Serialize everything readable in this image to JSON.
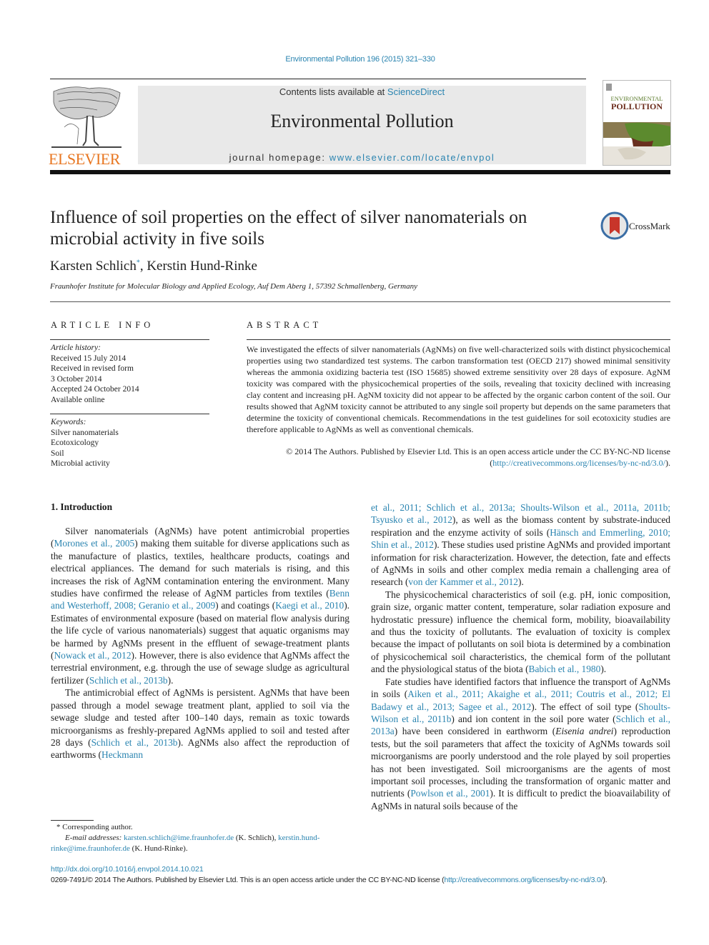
{
  "header": {
    "journal_reference": "Environmental Pollution 196 (2015) 321–330",
    "contents_prefix": "Contents lists available at ",
    "contents_link": "ScienceDirect",
    "journal_title": "Environmental Pollution",
    "homepage_prefix": "journal homepage: ",
    "homepage_link": "www.elsevier.com/locate/envpol",
    "publisher_logo": "ELSEVIER",
    "cover": {
      "title_line1": "ENVIRONMENTAL",
      "title_line2": "POLLUTION"
    },
    "colors": {
      "link": "#2a84b0",
      "elsevier_orange": "#e87722",
      "banner_bg": "#e9e9e9"
    }
  },
  "article": {
    "title": "Influence of soil properties on the effect of silver nanomaterials on microbial activity in five soils",
    "crossmark_label": "CrossMark",
    "authors": [
      {
        "name": "Karsten Schlich",
        "mark": "*"
      },
      {
        "name": "Kerstin Hund-Rinke",
        "mark": ""
      }
    ],
    "author_separator": ", ",
    "affiliation": "Fraunhofer Institute for Molecular Biology and Applied Ecology, Auf Dem Aberg 1, 57392 Schmallenberg, Germany"
  },
  "article_info": {
    "heading": "ARTICLE INFO",
    "history_label": "Article history:",
    "history": [
      "Received 15 July 2014",
      "Received in revised form",
      "3 October 2014",
      "Accepted 24 October 2014",
      "Available online"
    ],
    "keywords_label": "Keywords:",
    "keywords": [
      "Silver nanomaterials",
      "Ecotoxicology",
      "Soil",
      "Microbial activity"
    ]
  },
  "abstract": {
    "heading": "ABSTRACT",
    "text": "We investigated the effects of silver nanomaterials (AgNMs) on five well-characterized soils with distinct physicochemical properties using two standardized test systems. The carbon transformation test (OECD 217) showed minimal sensitivity whereas the ammonia oxidizing bacteria test (ISO 15685) showed extreme sensitivity over 28 days of exposure. AgNM toxicity was compared with the physicochemical properties of the soils, revealing that toxicity declined with increasing clay content and increasing pH. AgNM toxicity did not appear to be affected by the organic carbon content of the soil. Our results showed that AgNM toxicity cannot be attributed to any single soil property but depends on the same parameters that determine the toxicity of conventional chemicals. Recommendations in the test guidelines for soil ecotoxicity studies are therefore applicable to AgNMs as well as conventional chemicals.",
    "copyright_prefix": "© 2014 The Authors. Published by Elsevier Ltd. This is an open access article under the CC BY-NC-ND license (",
    "copyright_link": "http://creativecommons.org/licenses/by-nc-nd/3.0/",
    "copyright_suffix": ")."
  },
  "body": {
    "section_heading": "1.  Introduction",
    "left_paragraphs": [
      [
        {
          "t": "Silver nanomaterials (AgNMs) have potent antimicrobial properties ("
        },
        {
          "t": "Morones et al., 2005",
          "link": true
        },
        {
          "t": ") making them suitable for diverse applications such as the manufacture of plastics, textiles, healthcare products, coatings and electrical appliances. The demand for such materials is rising, and this increases the risk of AgNM contamination entering the environment. Many studies have confirmed the release of AgNM particles from textiles ("
        },
        {
          "t": "Benn and Westerhoff, 2008; Geranio et al., 2009",
          "link": true
        },
        {
          "t": ") and coatings ("
        },
        {
          "t": "Kaegi et al., 2010",
          "link": true
        },
        {
          "t": "). Estimates of environmental exposure (based on material flow analysis during the life cycle of various nanomaterials) suggest that aquatic organisms may be harmed by AgNMs present in the effluent of sewage-treatment plants ("
        },
        {
          "t": "Nowack et al., 2012",
          "link": true
        },
        {
          "t": "). However, there is also evidence that AgNMs affect the terrestrial environment, e.g. through the use of sewage sludge as agricultural fertilizer ("
        },
        {
          "t": "Schlich et al., 2013b",
          "link": true
        },
        {
          "t": ")."
        }
      ],
      [
        {
          "t": "The antimicrobial effect of AgNMs is persistent. AgNMs that have been passed through a model sewage treatment plant, applied to soil via the sewage sludge and tested after 100–140 days, remain as toxic towards microorganisms as freshly-prepared AgNMs applied to soil and tested after 28 days ("
        },
        {
          "t": "Schlich et al., 2013b",
          "link": true
        },
        {
          "t": "). AgNMs also affect the reproduction of earthworms ("
        },
        {
          "t": "Heckmann",
          "link": true
        }
      ]
    ],
    "right_paragraphs": [
      [
        {
          "t": "et al., 2011; Schlich et al., 2013a; Shoults-Wilson et al., 2011a, 2011b; Tsyusko et al., 2012",
          "link": true
        },
        {
          "t": "), as well as the biomass content by substrate-induced respiration and the enzyme activity of soils ("
        },
        {
          "t": "Hänsch and Emmerling, 2010; Shin et al., 2012",
          "link": true
        },
        {
          "t": "). These studies used pristine AgNMs and provided important information for risk characterization. However, the detection, fate and effects of AgNMs in soils and other complex media remain a challenging area of research ("
        },
        {
          "t": "von der Kammer et al., 2012",
          "link": true
        },
        {
          "t": ")."
        }
      ],
      [
        {
          "t": "The physicochemical characteristics of soil (e.g. pH, ionic composition, grain size, organic matter content, temperature, solar radiation exposure and hydrostatic pressure) influence the chemical form, mobility, bioavailability and thus the toxicity of pollutants. The evaluation of toxicity is complex because the impact of pollutants on soil biota is determined by a combination of physicochemical soil characteristics, the chemical form of the pollutant and the physiological status of the biota ("
        },
        {
          "t": "Babich et al., 1980",
          "link": true
        },
        {
          "t": ")."
        }
      ],
      [
        {
          "t": "Fate studies have identified factors that influence the transport of AgNMs in soils ("
        },
        {
          "t": "Aiken et al., 2011; Akaighe et al., 2011; Coutris et al., 2012; El Badawy et al., 2013; Sagee et al., 2012",
          "link": true
        },
        {
          "t": "). The effect of soil type ("
        },
        {
          "t": "Shoults-Wilson et al., 2011b",
          "link": true
        },
        {
          "t": ") and ion content in the soil pore water ("
        },
        {
          "t": "Schlich et al., 2013a",
          "link": true
        },
        {
          "t": ") have been considered in earthworm ("
        },
        {
          "t": "Eisenia andrei",
          "italic": true
        },
        {
          "t": ") reproduction tests, but the soil parameters that affect the toxicity of AgNMs towards soil microorganisms are poorly understood and the role played by soil properties has not been investigated. Soil microorganisms are the agents of most important soil processes, including the transformation of organic matter and nutrients ("
        },
        {
          "t": "Powlson et al., 2001",
          "link": true
        },
        {
          "t": "). It is difficult to predict the bioavailability of AgNMs in natural soils because of the"
        }
      ]
    ]
  },
  "footnote": {
    "mark": "*",
    "corresponding": "Corresponding author.",
    "email_label": "E-mail addresses:",
    "email1": "karsten.schlich@ime.fraunhofer.de",
    "email1_owner": " (K. Schlich), ",
    "email2": "kerstin.hund-rinke@ime.fraunhofer.de",
    "email2_owner": " (K. Hund-Rinke)."
  },
  "footer": {
    "doi": "http://dx.doi.org/10.1016/j.envpol.2014.10.021",
    "issn_prefix": "0269-7491/© 2014 The Authors. Published by Elsevier Ltd. This is an open access article under the CC BY-NC-ND license (",
    "license_link": "http://creativecommons.org/licenses/by-nc-nd/3.0/",
    "issn_suffix": ")."
  }
}
